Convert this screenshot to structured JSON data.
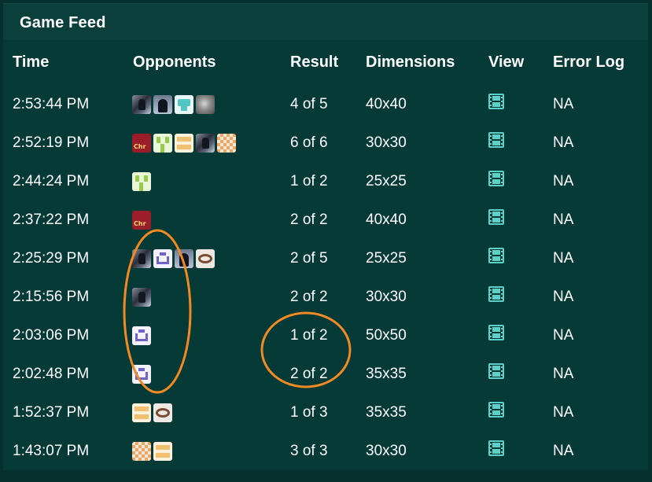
{
  "panel": {
    "title": "Game Feed"
  },
  "columns": {
    "time": "Time",
    "opponents": "Opponents",
    "result": "Result",
    "dimensions": "Dimensions",
    "view": "View",
    "error_log": "Error Log"
  },
  "rows": [
    {
      "time": "2:53:44 PM",
      "opponents": [
        "photo-avatar",
        "silhouette-avatar",
        "teal-robot-avatar",
        "gray-texture-avatar"
      ],
      "result": "4 of 5",
      "dimensions": "40x40",
      "view": "film-icon",
      "error_log": "NA"
    },
    {
      "time": "2:52:19 PM",
      "opponents": [
        "red-logo-avatar",
        "green-pixel-avatar",
        "orange-pixel-avatar",
        "photo-avatar",
        "checker-avatar"
      ],
      "result": "6 of 6",
      "dimensions": "30x30",
      "view": "film-icon",
      "error_log": "NA"
    },
    {
      "time": "2:44:24 PM",
      "opponents": [
        "green-pixel-avatar"
      ],
      "result": "1 of 2",
      "dimensions": "25x25",
      "view": "film-icon",
      "error_log": "NA"
    },
    {
      "time": "2:37:22 PM",
      "opponents": [
        "red-logo-avatar"
      ],
      "result": "2 of 2",
      "dimensions": "40x40",
      "view": "film-icon",
      "error_log": "NA"
    },
    {
      "time": "2:25:29 PM",
      "opponents": [
        "photo-avatar",
        "purple-pixel-avatar",
        "silhouette-avatar",
        "brown-ring-avatar"
      ],
      "result": "2 of 5",
      "dimensions": "25x25",
      "view": "film-icon",
      "error_log": "NA"
    },
    {
      "time": "2:15:56 PM",
      "opponents": [
        "photo-avatar"
      ],
      "result": "2 of 2",
      "dimensions": "30x30",
      "view": "film-icon",
      "error_log": "NA"
    },
    {
      "time": "2:03:06 PM",
      "opponents": [
        "purple-pixel-avatar"
      ],
      "result": "1 of 2",
      "dimensions": "50x50",
      "view": "film-icon",
      "error_log": "NA"
    },
    {
      "time": "2:02:48 PM",
      "opponents": [
        "purple-pixel-avatar"
      ],
      "result": "2 of 2",
      "dimensions": "35x35",
      "view": "film-icon",
      "error_log": "NA"
    },
    {
      "time": "1:52:37 PM",
      "opponents": [
        "orange-pixel-avatar",
        "brown-ring-avatar"
      ],
      "result": "1 of 3",
      "dimensions": "35x35",
      "view": "film-icon",
      "error_log": "NA"
    },
    {
      "time": "1:43:07 PM",
      "opponents": [
        "checker-avatar",
        "orange-pixel-avatar"
      ],
      "result": "3 of 3",
      "dimensions": "30x30",
      "view": "film-icon",
      "error_log": "NA"
    }
  ],
  "annotations": {
    "color": "#f08a24"
  },
  "colors": {
    "background": "#053a37",
    "text": "#ffffff",
    "icon": "#5fd0c8",
    "annotation": "#f08a24"
  }
}
